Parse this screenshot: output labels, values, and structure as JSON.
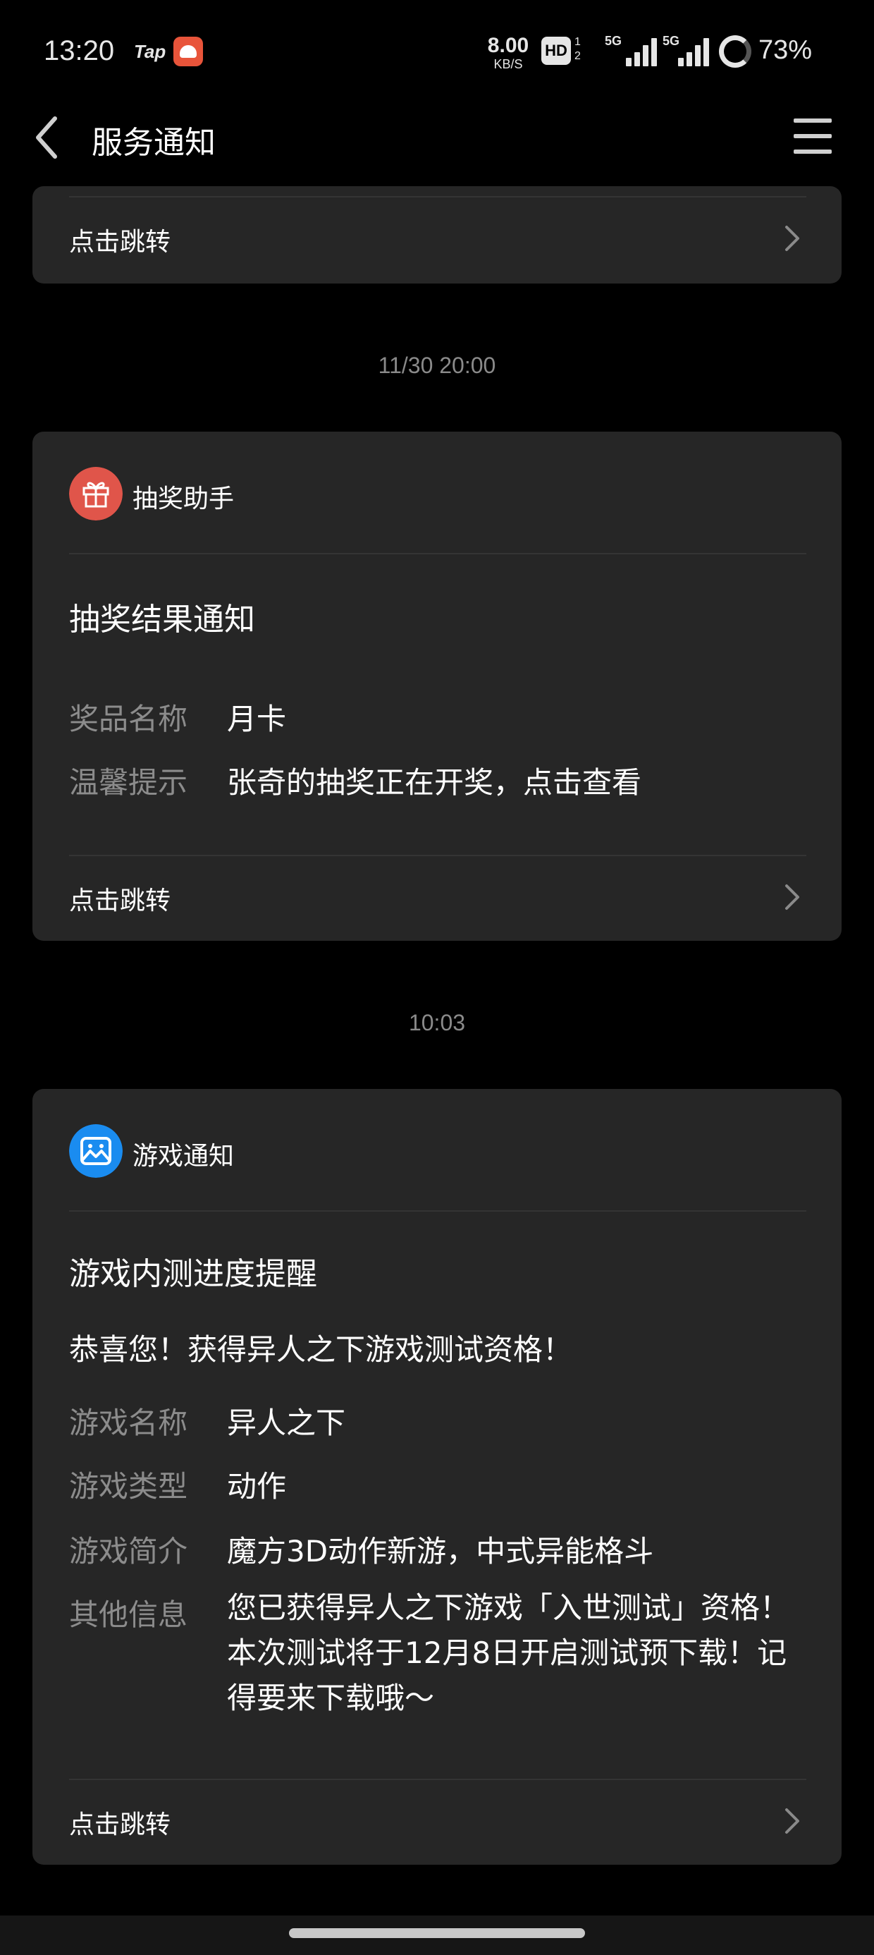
{
  "status_bar": {
    "time": "13:20",
    "tap_label": "Tap",
    "net_speed": "8.00",
    "net_unit": "KB/S",
    "hd_label": "HD",
    "hd_index": "1\n2",
    "sim1_label": "5G",
    "sim2_label": "5G",
    "battery_percent": "73%",
    "battery_level": 0.73
  },
  "header": {
    "title": "服务通知",
    "back_icon": "chevron-left-icon",
    "menu_icon": "hamburger-menu-icon"
  },
  "messages": [
    {
      "jump_label": "点击跳转"
    },
    {
      "time": "11/30 20:00",
      "source_name": "抽奖助手",
      "source_icon": "gift-icon",
      "source_color": "#e0554a",
      "title": "抽奖结果通知",
      "fields": [
        {
          "label": "奖品名称",
          "value": "月卡"
        },
        {
          "label": "温馨提示",
          "value": "张奇的抽奖正在开奖，点击查看"
        }
      ],
      "jump_label": "点击跳转"
    },
    {
      "time": "10:03",
      "source_name": "游戏通知",
      "source_icon": "gamepad-icon",
      "source_color": "#1a8cf0",
      "title": "游戏内测进度提醒",
      "intro": "恭喜您！获得异人之下游戏测试资格！",
      "fields": [
        {
          "label": "游戏名称",
          "value": "异人之下"
        },
        {
          "label": "游戏类型",
          "value": "动作"
        },
        {
          "label": "游戏简介",
          "value": "魔方3D动作新游，中式异能格斗"
        },
        {
          "label": "其他信息",
          "value": "您已获得异人之下游戏「入世测试」资格！本次测试将于12月8日开启测试预下载！记得要来下载哦～"
        }
      ],
      "jump_label": "点击跳转"
    }
  ]
}
